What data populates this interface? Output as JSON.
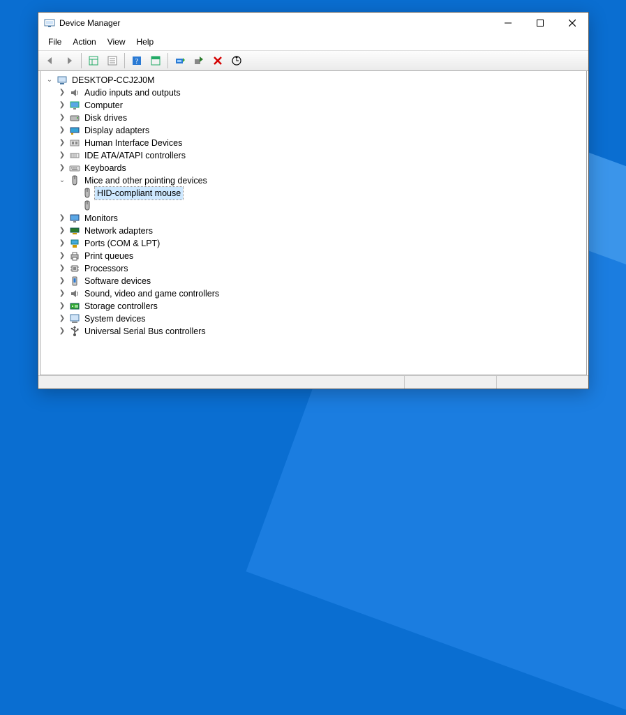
{
  "window": {
    "title": "Device Manager"
  },
  "menu": {
    "file": "File",
    "action": "Action",
    "view": "View",
    "help": "Help"
  },
  "tree": {
    "root": "DESKTOP-CCJ2J0M",
    "audio": "Audio inputs and outputs",
    "computer": "Computer",
    "disk": "Disk drives",
    "display": "Display adapters",
    "hid": "Human Interface Devices",
    "ide": "IDE ATA/ATAPI controllers",
    "keyboards": "Keyboards",
    "mice": "Mice and other pointing devices",
    "mice_child1": "HID-compliant mouse",
    "mice_child2": "",
    "monitors": "Monitors",
    "network": "Network adapters",
    "ports": "Ports (COM & LPT)",
    "print": "Print queues",
    "processors": "Processors",
    "software": "Software devices",
    "sound": "Sound, video and game controllers",
    "storage": "Storage controllers",
    "system": "System devices",
    "usb": "Universal Serial Bus controllers"
  }
}
